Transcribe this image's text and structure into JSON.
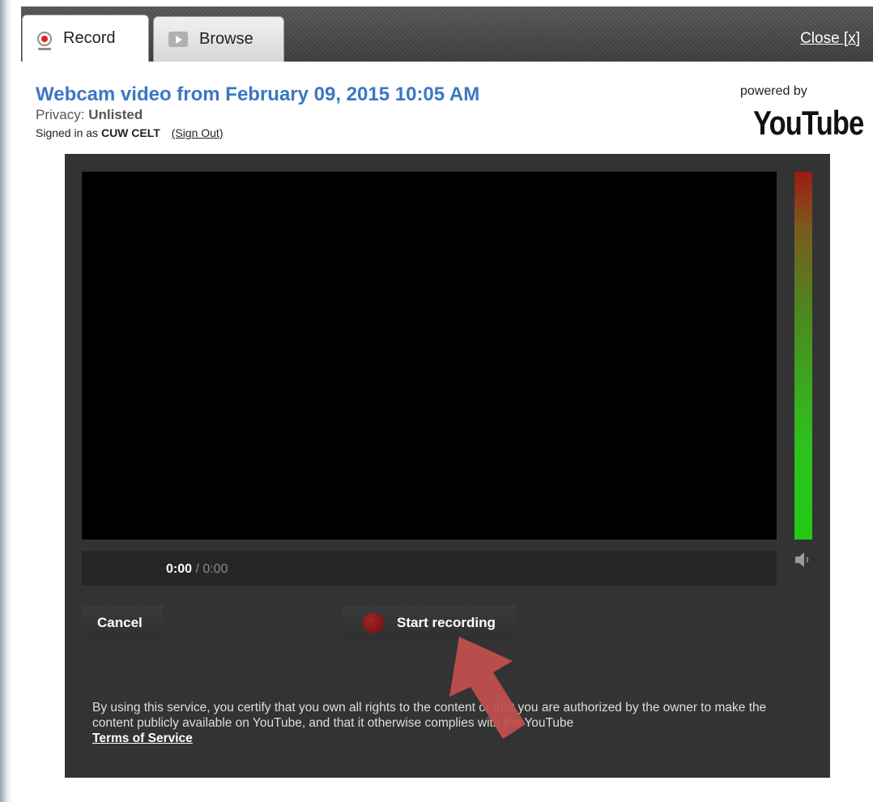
{
  "tabs": [
    {
      "label": "Record",
      "icon": "webcam-record-icon",
      "active": true
    },
    {
      "label": "Browse",
      "icon": "play-icon",
      "active": false
    }
  ],
  "close_label": "Close [x]",
  "header": {
    "title": "Webcam video from February 09, 2015 10:05 AM",
    "privacy_label": "Privacy:",
    "privacy_value": "Unlisted",
    "signed_in_label": "Signed in as",
    "account_name": "CUW CELT",
    "sign_out_label": "(Sign Out)",
    "powered_by": "powered by",
    "brand": "YouTube"
  },
  "player": {
    "time_current": "0:00",
    "time_separator": " / ",
    "time_total": "0:00",
    "audio_meter_icon": "volume-icon"
  },
  "actions": {
    "cancel_label": "Cancel",
    "start_label": "Start recording"
  },
  "notice": {
    "text": "By using this service, you certify that you own all rights to the content or that you are authorized by the owner to make the content publicly available on YouTube, and that it otherwise complies with the YouTube ",
    "tos_label": "Terms of Service"
  },
  "colors": {
    "title": "#3b77c4",
    "panel": "#333333",
    "record_dot": "#8b1a1a",
    "annotation_arrow": "#c0504d"
  }
}
